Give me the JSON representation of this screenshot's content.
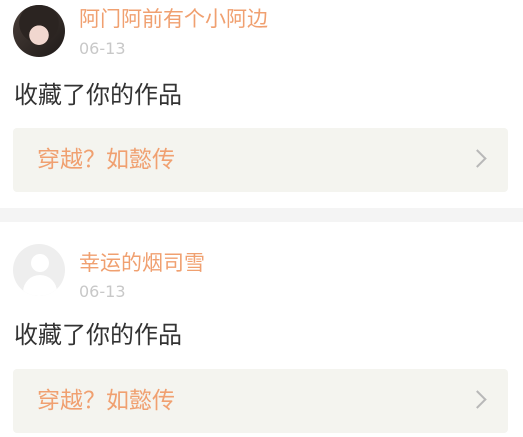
{
  "notifications": [
    {
      "username": "阿门阿前有个小阿边",
      "date": "06-13",
      "action": "收藏了你的作品",
      "work_title": "穿越？如懿传",
      "avatar": "user-photo"
    },
    {
      "username": "幸运的烟司雪",
      "date": "06-13",
      "action": "收藏了你的作品",
      "work_title": "穿越？如懿传",
      "avatar": "default-avatar-icon"
    }
  ],
  "colors": {
    "username": "#f0a070",
    "date": "#c8c8c8",
    "action": "#333333",
    "work_box": "#f4f4ef",
    "separator": "#f4f4f4"
  },
  "icons": {
    "chevron": "chevron-right-icon"
  }
}
